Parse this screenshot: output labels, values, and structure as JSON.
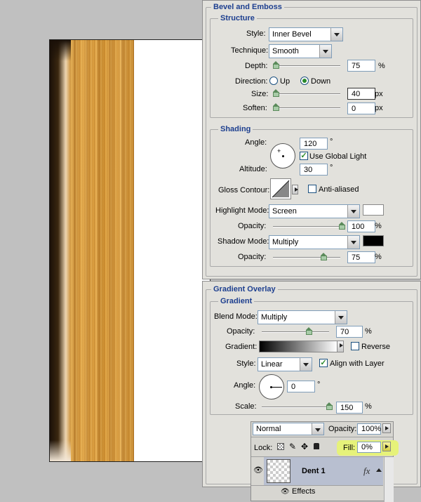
{
  "bevel": {
    "section_title": "Bevel and Emboss",
    "structure_title": "Structure",
    "style": {
      "label": "Style:",
      "value": "Inner Bevel"
    },
    "technique": {
      "label": "Technique:",
      "value": "Smooth"
    },
    "depth": {
      "label": "Depth:",
      "value": "75",
      "unit": "%",
      "level": 0.75
    },
    "direction": {
      "label": "Direction:",
      "up": "Up",
      "down": "Down",
      "selected": "Down"
    },
    "size": {
      "label": "Size:",
      "value": "40",
      "unit": "px",
      "level": 0.16
    },
    "soften": {
      "label": "Soften:",
      "value": "0",
      "unit": "px",
      "level": 0.0
    },
    "shading_title": "Shading",
    "angle": {
      "label": "Angle:",
      "value": "120",
      "unit": "°"
    },
    "use_global_light": {
      "label": "Use Global Light",
      "checked": true
    },
    "altitude": {
      "label": "Altitude:",
      "value": "30",
      "unit": "°"
    },
    "gloss_contour": {
      "label": "Gloss Contour:"
    },
    "anti_aliased": {
      "label": "Anti-aliased",
      "checked": false
    },
    "highlight_mode": {
      "label": "Highlight Mode:",
      "value": "Screen",
      "color": "#ffffff"
    },
    "highlight_opacity": {
      "label": "Opacity:",
      "value": "100",
      "unit": "%",
      "level": 1.0
    },
    "shadow_mode": {
      "label": "Shadow Mode:",
      "value": "Multiply",
      "color": "#000000"
    },
    "shadow_opacity": {
      "label": "Opacity:",
      "value": "75",
      "unit": "%",
      "level": 0.75
    }
  },
  "gradient_overlay": {
    "section_title": "Gradient Overlay",
    "gradient_title": "Gradient",
    "blend_mode": {
      "label": "Blend Mode:",
      "value": "Multiply"
    },
    "opacity": {
      "label": "Opacity:",
      "value": "70",
      "unit": "%",
      "level": 0.7
    },
    "gradient": {
      "label": "Gradient:"
    },
    "reverse": {
      "label": "Reverse",
      "checked": false
    },
    "style": {
      "label": "Style:",
      "value": "Linear"
    },
    "align_with_layer": {
      "label": "Align with Layer",
      "checked": true
    },
    "angle": {
      "label": "Angle:",
      "value": "0",
      "unit": "°"
    },
    "scale": {
      "label": "Scale:",
      "value": "150",
      "unit": "%",
      "level": 1.0
    }
  },
  "layers": {
    "blend_mode": "Normal",
    "opacity_label": "Opacity:",
    "opacity_value": "100%",
    "lock_label": "Lock:",
    "fill_label": "Fill:",
    "fill_value": "0%",
    "layer_name": "Dent 1",
    "fx": "fx",
    "effects_label": "Effects"
  }
}
